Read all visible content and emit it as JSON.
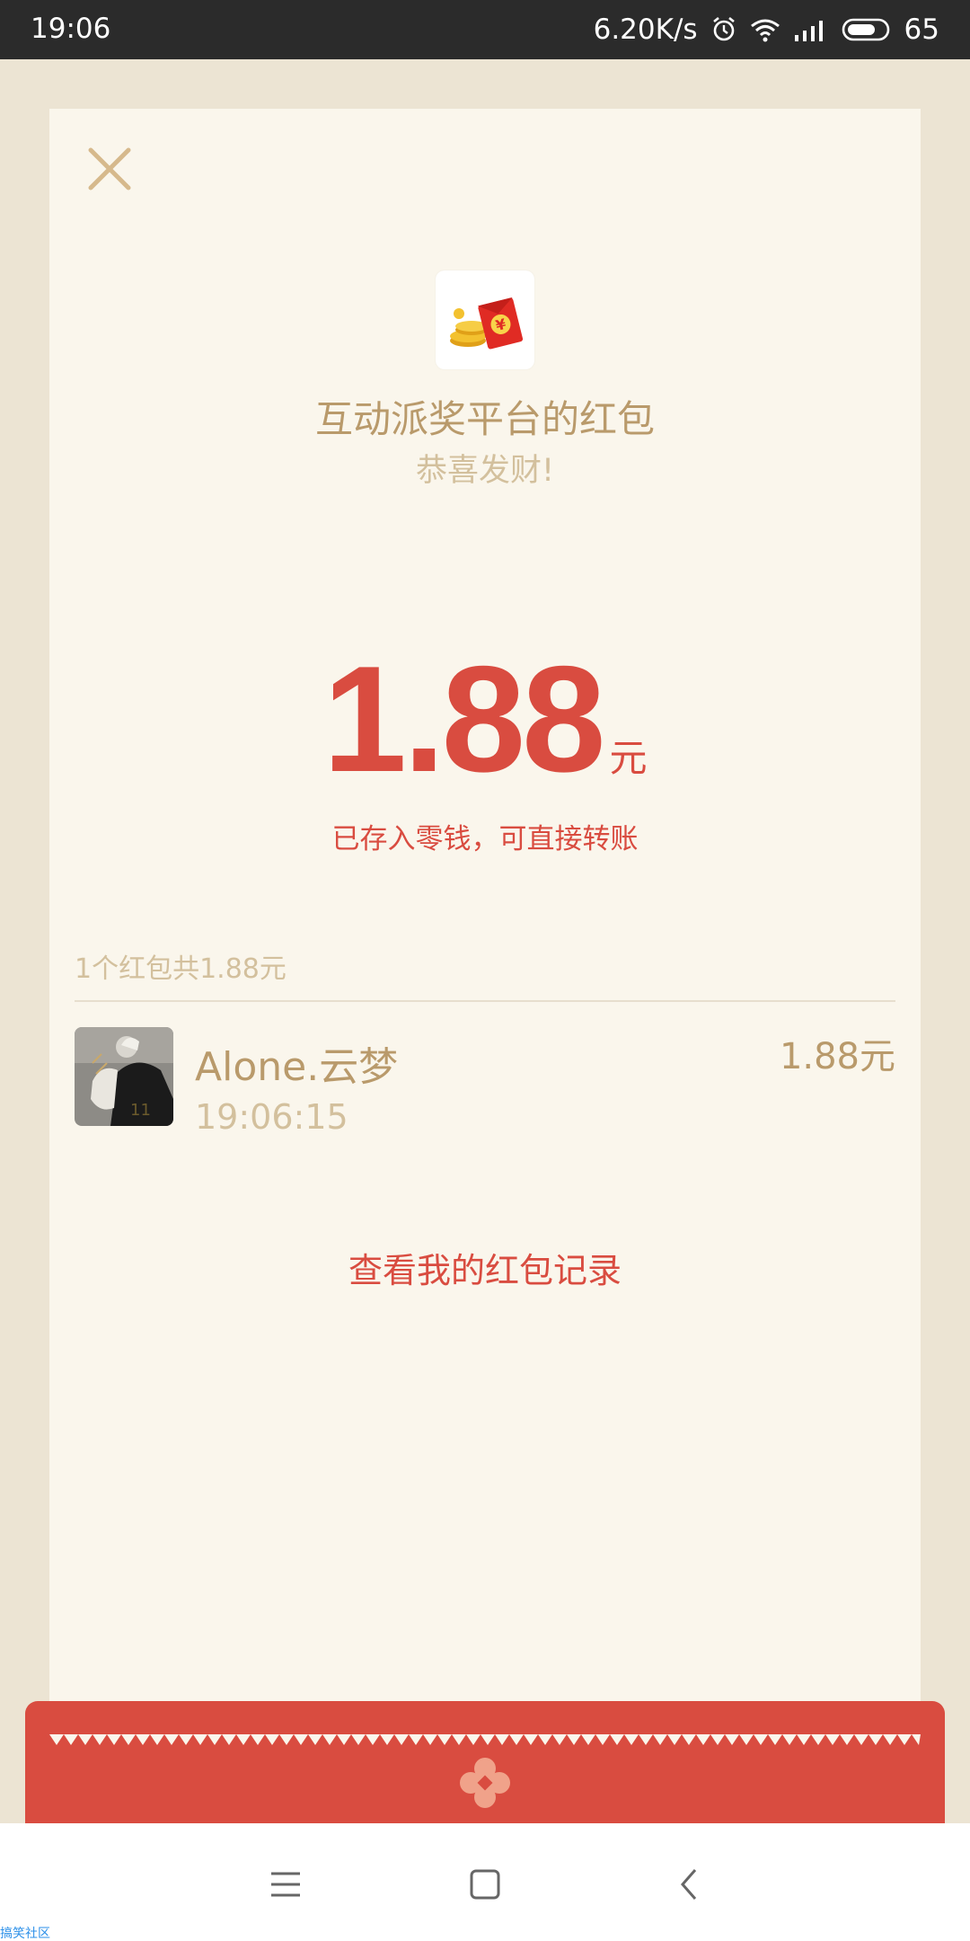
{
  "status_bar": {
    "time": "19:06",
    "net_speed": "6.20K/s",
    "battery": "65",
    "icons": [
      "alarm-icon",
      "wifi-icon",
      "signal-icon",
      "battery-icon"
    ]
  },
  "header": {
    "close_icon": "close-icon",
    "app_icon": "red-packet-icon",
    "title": "互动派奖平台的红包",
    "wish": "恭喜发财!"
  },
  "amount": {
    "value": "1.88",
    "unit": "元",
    "note": "已存入零钱，可直接转账"
  },
  "summary": "1个红包共1.88元",
  "records": [
    {
      "name": "Alone.云梦",
      "time": "19:06:15",
      "amount": "1.88元"
    }
  ],
  "link": "查看我的红包记录",
  "nav": {
    "icons": [
      "menu-icon",
      "home-icon",
      "back-icon"
    ]
  },
  "watermark": "搞笑社区",
  "colors": {
    "accent_red": "#d94c40",
    "gold": "#b99a6b",
    "light_gold": "#d3c09d",
    "card_bg": "#faf6ec",
    "page_bg": "#ece4d3"
  }
}
